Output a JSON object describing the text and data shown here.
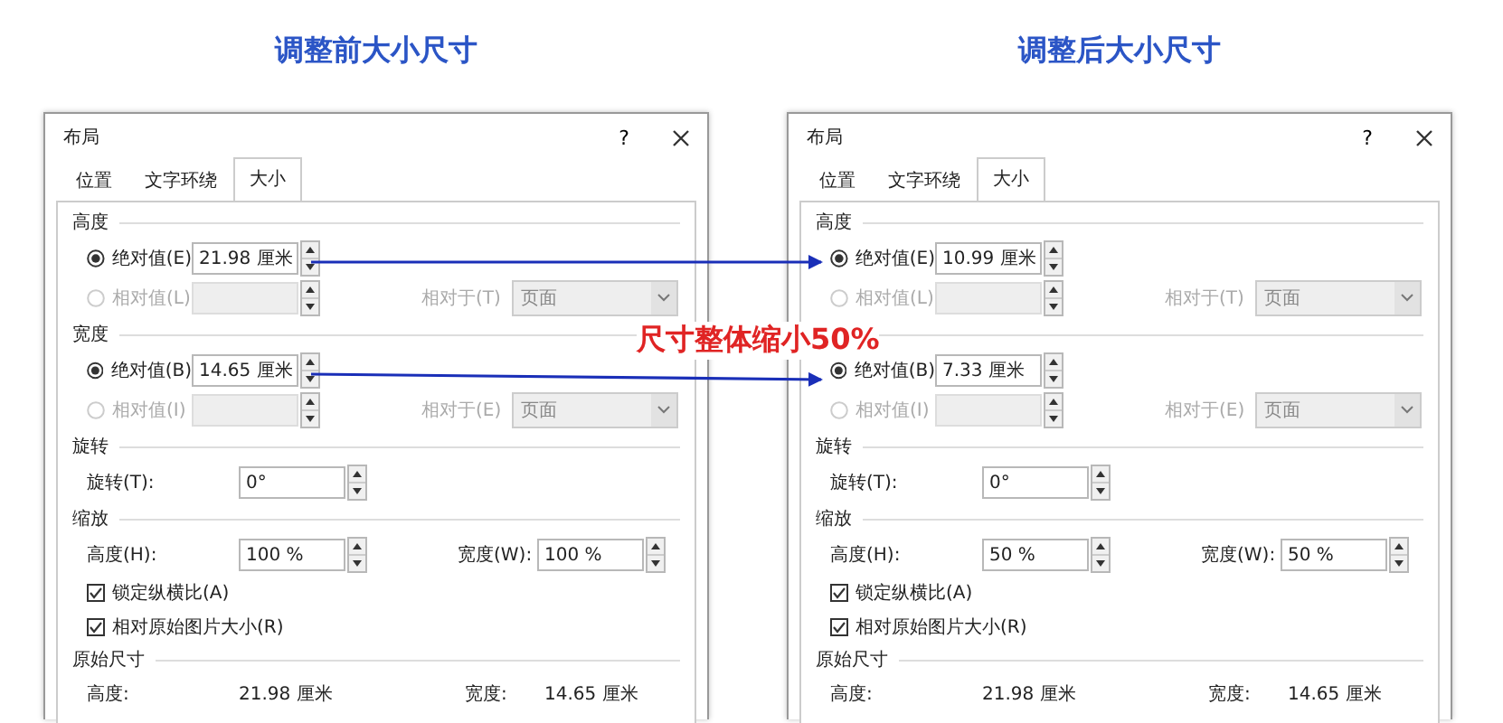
{
  "headings": [
    "调整前大小尺寸",
    "调整后大小尺寸"
  ],
  "dialogs": [
    {
      "title": "布局",
      "help": "?",
      "tabs": [
        {
          "label": "位置",
          "selected": false
        },
        {
          "label": "文字环绕",
          "selected": false
        },
        {
          "label": "大小",
          "selected": true
        }
      ],
      "sections": [
        {
          "title": "高度",
          "rows": [
            {
              "kind": "radio",
              "label": "绝对值(E)",
              "selected": true,
              "disabled": false,
              "value": "21.98 厘米"
            },
            {
              "kind": "radio",
              "label": "相对值(L)",
              "selected": false,
              "disabled": true,
              "relative_label": "相对于(T)",
              "relative_value": "页面"
            }
          ]
        },
        {
          "title": "宽度",
          "rows": [
            {
              "kind": "radio",
              "label": "绝对值(B)",
              "selected": true,
              "disabled": false,
              "value": "14.65 厘米"
            },
            {
              "kind": "radio",
              "label": "相对值(I)",
              "selected": false,
              "disabled": true,
              "relative_label": "相对于(E)",
              "relative_value": "页面"
            }
          ]
        },
        {
          "title": "旋转",
          "rows": [
            {
              "kind": "spin",
              "label": "旋转(T):",
              "value": "0°"
            }
          ]
        },
        {
          "title": "缩放",
          "rows": [
            {
              "kind": "spin-pair",
              "label": "高度(H):",
              "value": "100 %",
              "label_2": "宽度(W):",
              "value_2": "100 %"
            },
            {
              "kind": "checkbox",
              "label": "锁定纵横比(A)",
              "checked": true
            },
            {
              "kind": "checkbox",
              "label": "相对原始图片大小(R)",
              "checked": true
            }
          ]
        },
        {
          "title": "原始尺寸",
          "rows": [
            {
              "kind": "info-pair",
              "label": "高度:",
              "value": "21.98 厘米",
              "label_2": "宽度:",
              "value_2": "14.65 厘米"
            }
          ]
        }
      ]
    },
    {
      "title": "布局",
      "help": "?",
      "tabs": [
        {
          "label": "位置",
          "selected": false
        },
        {
          "label": "文字环绕",
          "selected": false
        },
        {
          "label": "大小",
          "selected": true
        }
      ],
      "sections": [
        {
          "title": "高度",
          "rows": [
            {
              "kind": "radio",
              "label": "绝对值(E)",
              "selected": true,
              "disabled": false,
              "value": "10.99 厘米"
            },
            {
              "kind": "radio",
              "label": "相对值(L)",
              "selected": false,
              "disabled": true,
              "relative_label": "相对于(T)",
              "relative_value": "页面"
            }
          ]
        },
        {
          "rows": [
            {
              "kind": "radio",
              "label": "绝对值(B)",
              "selected": true,
              "disabled": false,
              "value": "7.33 厘米"
            },
            {
              "kind": "radio",
              "label": "相对值(I)",
              "selected": false,
              "disabled": true,
              "relative_label": "相对于(E)",
              "relative_value": "页面"
            }
          ]
        },
        {
          "title": "旋转",
          "rows": [
            {
              "kind": "spin",
              "label": "旋转(T):",
              "value": "0°"
            }
          ]
        },
        {
          "title": "缩放",
          "rows": [
            {
              "kind": "spin-pair",
              "label": "高度(H):",
              "value": "50 %",
              "label_2": "宽度(W):",
              "value_2": "50 %"
            },
            {
              "kind": "checkbox",
              "label": "锁定纵横比(A)",
              "checked": true
            },
            {
              "kind": "checkbox",
              "label": "相对原始图片大小(R)",
              "checked": true
            }
          ]
        },
        {
          "title": "原始尺寸",
          "rows": [
            {
              "kind": "info-pair",
              "label": "高度:",
              "value": "21.98 厘米",
              "label_2": "宽度:",
              "value_2": "14.65 厘米"
            }
          ]
        }
      ]
    }
  ],
  "annotation": "尺寸整体缩小50%"
}
